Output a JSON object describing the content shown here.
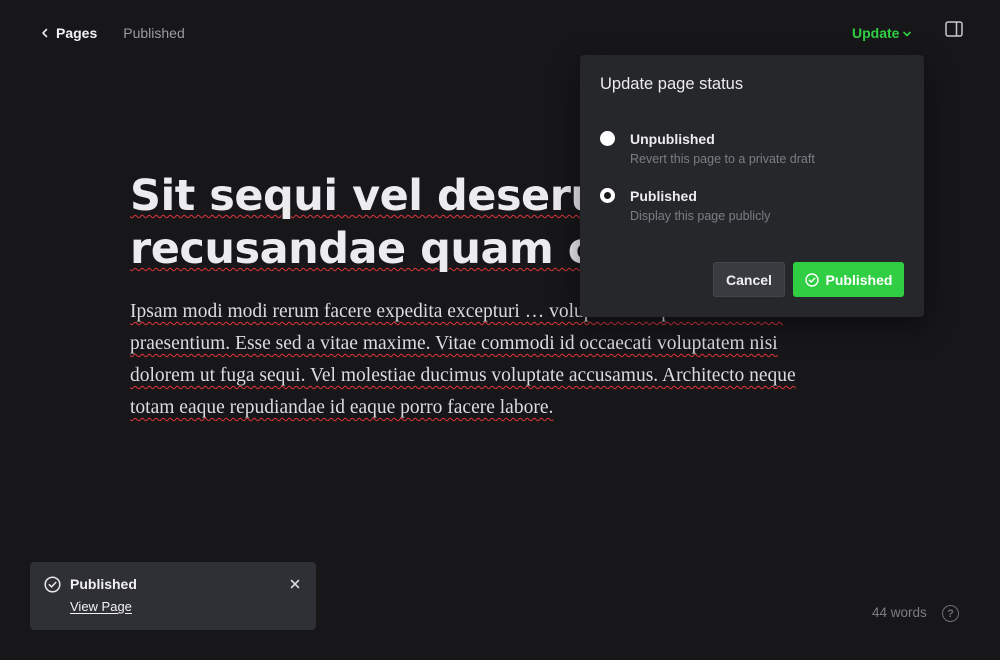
{
  "header": {
    "back_label": "Pages",
    "status": "Published",
    "update_label": "Update"
  },
  "post": {
    "title": "Sit sequi vel deserunt recusandae quam co",
    "body": "Ipsam modi modi rerum facere expedita excepturi … voluptate voluptatum maxime praesentium. Esse sed a vitae maxime. Vitae commodi id occaecati voluptatem nisi dolorem ut fuga sequi. Vel molestiae ducimus voluptate accusamus. Architecto neque totam eaque repudiandae id eaque porro facere labore."
  },
  "popover": {
    "title": "Update page status",
    "options": [
      {
        "label": "Unpublished",
        "description": "Revert this page to a private draft",
        "selected": false
      },
      {
        "label": "Published",
        "description": "Display this page publicly",
        "selected": true
      }
    ],
    "cancel_label": "Cancel",
    "confirm_label": "Published"
  },
  "toast": {
    "title": "Published",
    "link": "View Page"
  },
  "footer": {
    "word_count": "44 words",
    "help_glyph": "?"
  },
  "colors": {
    "accent": "#30cf43",
    "background": "#17171a",
    "popover": "#26272b"
  },
  "icons": [
    "chevron-left-icon",
    "chevron-down-icon",
    "sidebar-toggle-icon",
    "check-circle-icon",
    "close-icon",
    "help-icon"
  ]
}
